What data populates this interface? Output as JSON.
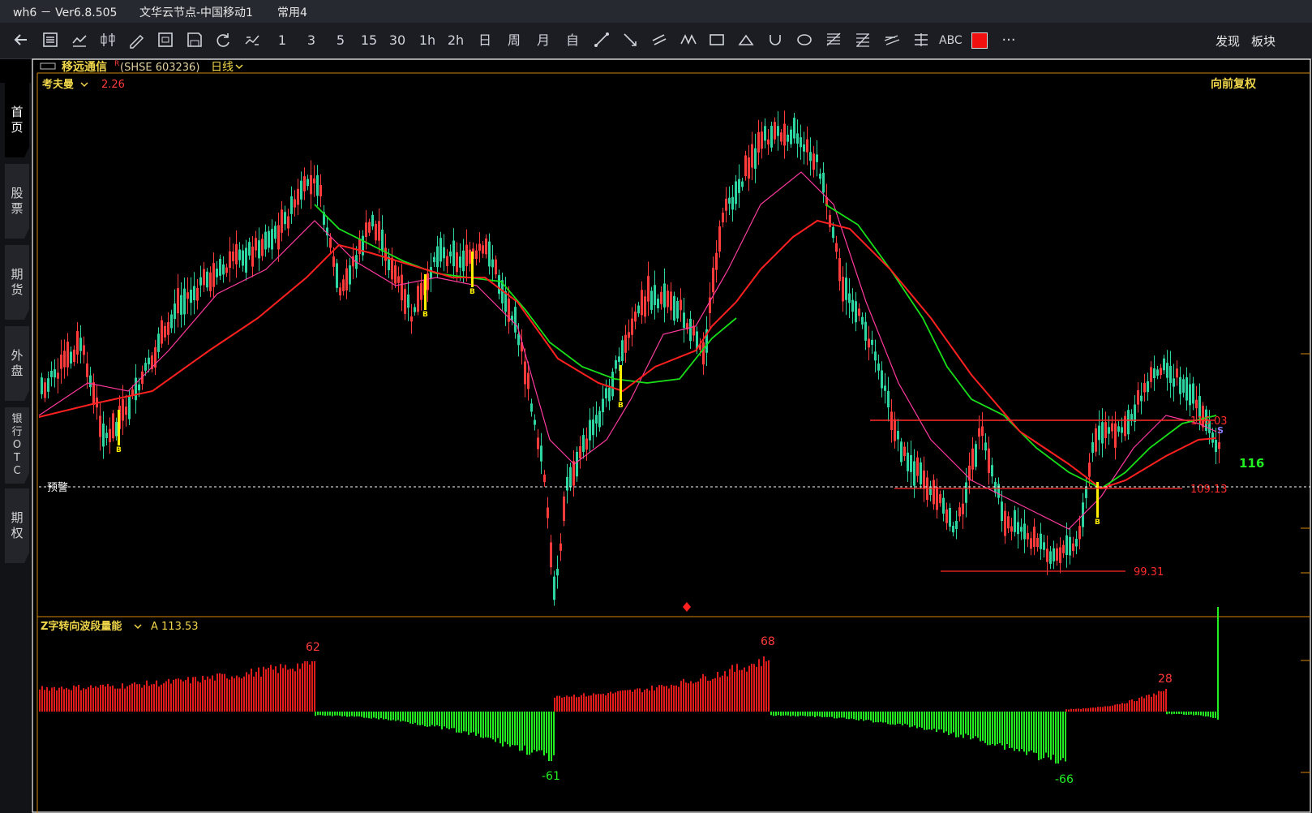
{
  "window": {
    "app_title": "wh6 － Ver6.8.505",
    "server": "文华云节点-中国移动1",
    "profile": "常用4"
  },
  "toolbar": {
    "icons": [
      "back-arrow-icon",
      "list-icon",
      "line-chart-icon",
      "candlestick-icon",
      "pencil-chart-icon",
      "grid-chart-icon",
      "save-icon",
      "refresh-icon",
      "switch-icon"
    ],
    "periods": [
      "1",
      "3",
      "5",
      "15",
      "30",
      "1h",
      "2h",
      "日",
      "周",
      "月",
      "自"
    ],
    "draw_tools": [
      "line-segment-icon",
      "ray-icon",
      "parallel-lines-icon",
      "zigzag-icon",
      "rectangle-icon",
      "triangle-icon",
      "arc-icon",
      "ellipse-icon",
      "fibonacci-icon",
      "gann-icon",
      "channel-icon",
      "level-icon"
    ],
    "abc_label": "ABC",
    "more_label": "···",
    "right_links": [
      "发现",
      "板块"
    ]
  },
  "sidebar": {
    "tabs": [
      {
        "label": "首页",
        "active": true
      },
      {
        "label": "股票",
        "active": false
      },
      {
        "label": "期货",
        "active": false
      },
      {
        "label": "外盘",
        "active": false
      },
      {
        "label": "银行OTC",
        "active": false
      },
      {
        "label": "期权",
        "active": false
      }
    ]
  },
  "chart_header": {
    "name": "移远通信",
    "mark": "R",
    "code": "(SHSE 603236)",
    "period": "日线",
    "indicator_name": "考夫曼",
    "indicator_value": "2.26",
    "adjust": "向前复权"
  },
  "price_panel": {
    "ymin": 80,
    "ymax": 160,
    "lines": [
      {
        "label": "116.03",
        "value": 116.03,
        "color": "#ff2a2a"
      },
      {
        "label": "109.13",
        "value": 109.13,
        "color": "#ff2a2a"
      },
      {
        "label": "99.31",
        "value": 99.31,
        "color": "#ff2a2a"
      }
    ],
    "alert_label": "预警",
    "alert_value": 109.13,
    "last_price_label": "116",
    "signal_b": "B",
    "signal_s": "S"
  },
  "sub_panel": {
    "indicator_name": "Z字转向波段量能",
    "indicator_value": "A 113.53",
    "peak_labels": [
      "62",
      "-61",
      "68",
      "-66",
      "28"
    ]
  },
  "colors": {
    "up": "#2dd6a0",
    "down": "#ff3b3b",
    "ma_fast": "#ff3aa0",
    "ma_slow": "#ff2020",
    "ma_green": "#18e018",
    "bar_pos": "#e21b1b",
    "bar_neg": "#22ee22",
    "orange": "#d4880b"
  }
}
